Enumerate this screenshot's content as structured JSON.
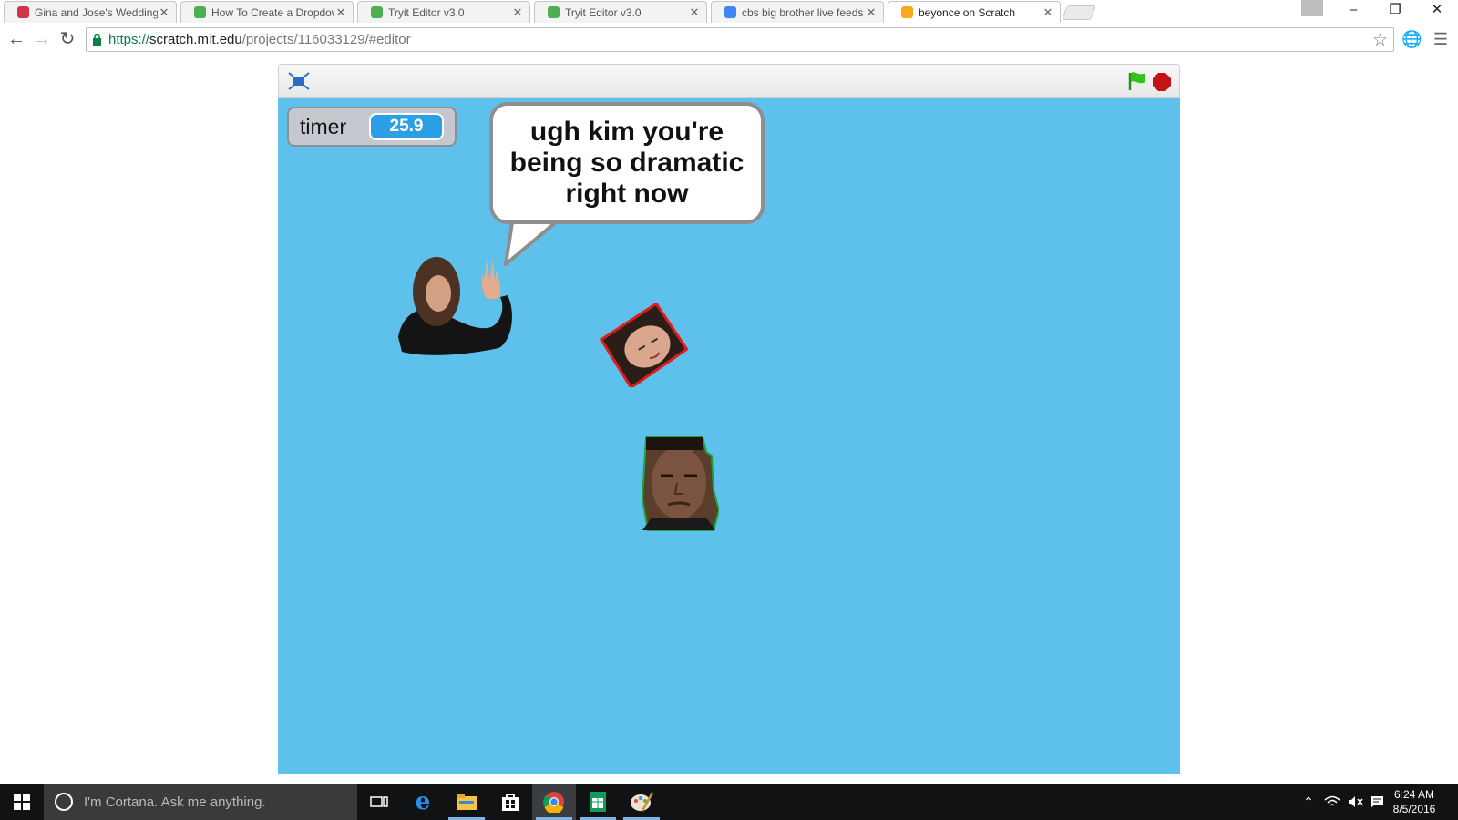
{
  "browser": {
    "tabs": [
      {
        "title": "Gina and Jose's Wedding!",
        "favicon": "heart-icon",
        "color": "#d0344a",
        "active": false
      },
      {
        "title": "How To Create a Dropdow",
        "favicon": "w3-icon",
        "color": "#4caf50",
        "active": false
      },
      {
        "title": "Tryit Editor v3.0",
        "favicon": "w3-icon",
        "color": "#4caf50",
        "active": false
      },
      {
        "title": "Tryit Editor v3.0",
        "favicon": "w3-icon",
        "color": "#4caf50",
        "active": false
      },
      {
        "title": "cbs big brother live feeds",
        "favicon": "google-icon",
        "color": "#4285f4",
        "active": false
      },
      {
        "title": "beyonce on Scratch",
        "favicon": "scratch-icon",
        "color": "#f7a81b",
        "active": true
      }
    ],
    "url": {
      "scheme": "https://",
      "host": "scratch.mit.edu",
      "path": "/projects/116033129/#editor"
    }
  },
  "scratch": {
    "monitor": {
      "label": "timer",
      "value": "25.9"
    },
    "speech_bubble": "ugh kim you're being so dramatic right now",
    "sprites": [
      "woman-waving-sprite",
      "kim-head-sprite",
      "kanye-head-sprite"
    ],
    "stage_color": "#5ec1ec"
  },
  "taskbar": {
    "cortana_placeholder": "I'm Cortana. Ask me anything.",
    "apps": [
      "task-view-icon",
      "edge-icon",
      "file-explorer-icon",
      "store-icon",
      "chrome-icon",
      "sheets-icon",
      "paint-icon"
    ],
    "clock": {
      "time": "6:24 AM",
      "date": "8/5/2016"
    }
  }
}
